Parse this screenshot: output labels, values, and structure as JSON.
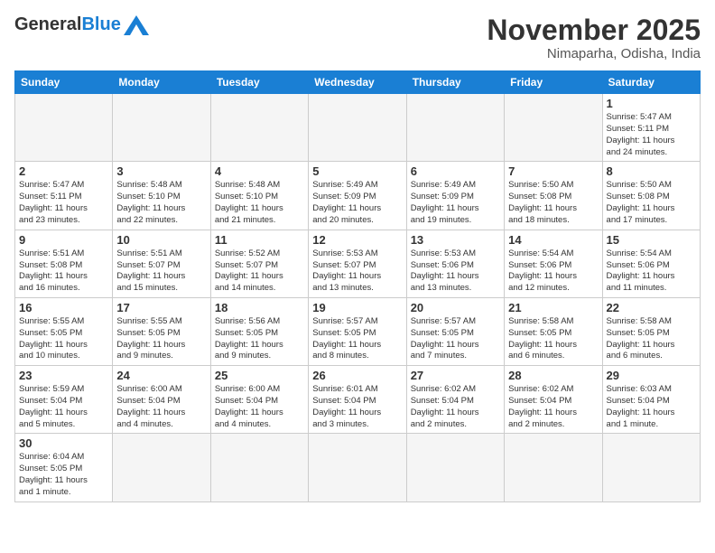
{
  "header": {
    "logo_general": "General",
    "logo_blue": "Blue",
    "month_title": "November 2025",
    "location": "Nimaparha, Odisha, India"
  },
  "days_of_week": [
    "Sunday",
    "Monday",
    "Tuesday",
    "Wednesday",
    "Thursday",
    "Friday",
    "Saturday"
  ],
  "weeks": [
    [
      {
        "day": "",
        "info": ""
      },
      {
        "day": "",
        "info": ""
      },
      {
        "day": "",
        "info": ""
      },
      {
        "day": "",
        "info": ""
      },
      {
        "day": "",
        "info": ""
      },
      {
        "day": "",
        "info": ""
      },
      {
        "day": "1",
        "info": "Sunrise: 5:47 AM\nSunset: 5:11 PM\nDaylight: 11 hours\nand 24 minutes."
      }
    ],
    [
      {
        "day": "2",
        "info": "Sunrise: 5:47 AM\nSunset: 5:11 PM\nDaylight: 11 hours\nand 23 minutes."
      },
      {
        "day": "3",
        "info": "Sunrise: 5:48 AM\nSunset: 5:10 PM\nDaylight: 11 hours\nand 22 minutes."
      },
      {
        "day": "4",
        "info": "Sunrise: 5:48 AM\nSunset: 5:10 PM\nDaylight: 11 hours\nand 21 minutes."
      },
      {
        "day": "5",
        "info": "Sunrise: 5:49 AM\nSunset: 5:09 PM\nDaylight: 11 hours\nand 20 minutes."
      },
      {
        "day": "6",
        "info": "Sunrise: 5:49 AM\nSunset: 5:09 PM\nDaylight: 11 hours\nand 19 minutes."
      },
      {
        "day": "7",
        "info": "Sunrise: 5:50 AM\nSunset: 5:08 PM\nDaylight: 11 hours\nand 18 minutes."
      },
      {
        "day": "8",
        "info": "Sunrise: 5:50 AM\nSunset: 5:08 PM\nDaylight: 11 hours\nand 17 minutes."
      }
    ],
    [
      {
        "day": "9",
        "info": "Sunrise: 5:51 AM\nSunset: 5:08 PM\nDaylight: 11 hours\nand 16 minutes."
      },
      {
        "day": "10",
        "info": "Sunrise: 5:51 AM\nSunset: 5:07 PM\nDaylight: 11 hours\nand 15 minutes."
      },
      {
        "day": "11",
        "info": "Sunrise: 5:52 AM\nSunset: 5:07 PM\nDaylight: 11 hours\nand 14 minutes."
      },
      {
        "day": "12",
        "info": "Sunrise: 5:53 AM\nSunset: 5:07 PM\nDaylight: 11 hours\nand 13 minutes."
      },
      {
        "day": "13",
        "info": "Sunrise: 5:53 AM\nSunset: 5:06 PM\nDaylight: 11 hours\nand 13 minutes."
      },
      {
        "day": "14",
        "info": "Sunrise: 5:54 AM\nSunset: 5:06 PM\nDaylight: 11 hours\nand 12 minutes."
      },
      {
        "day": "15",
        "info": "Sunrise: 5:54 AM\nSunset: 5:06 PM\nDaylight: 11 hours\nand 11 minutes."
      }
    ],
    [
      {
        "day": "16",
        "info": "Sunrise: 5:55 AM\nSunset: 5:05 PM\nDaylight: 11 hours\nand 10 minutes."
      },
      {
        "day": "17",
        "info": "Sunrise: 5:55 AM\nSunset: 5:05 PM\nDaylight: 11 hours\nand 9 minutes."
      },
      {
        "day": "18",
        "info": "Sunrise: 5:56 AM\nSunset: 5:05 PM\nDaylight: 11 hours\nand 9 minutes."
      },
      {
        "day": "19",
        "info": "Sunrise: 5:57 AM\nSunset: 5:05 PM\nDaylight: 11 hours\nand 8 minutes."
      },
      {
        "day": "20",
        "info": "Sunrise: 5:57 AM\nSunset: 5:05 PM\nDaylight: 11 hours\nand 7 minutes."
      },
      {
        "day": "21",
        "info": "Sunrise: 5:58 AM\nSunset: 5:05 PM\nDaylight: 11 hours\nand 6 minutes."
      },
      {
        "day": "22",
        "info": "Sunrise: 5:58 AM\nSunset: 5:05 PM\nDaylight: 11 hours\nand 6 minutes."
      }
    ],
    [
      {
        "day": "23",
        "info": "Sunrise: 5:59 AM\nSunset: 5:04 PM\nDaylight: 11 hours\nand 5 minutes."
      },
      {
        "day": "24",
        "info": "Sunrise: 6:00 AM\nSunset: 5:04 PM\nDaylight: 11 hours\nand 4 minutes."
      },
      {
        "day": "25",
        "info": "Sunrise: 6:00 AM\nSunset: 5:04 PM\nDaylight: 11 hours\nand 4 minutes."
      },
      {
        "day": "26",
        "info": "Sunrise: 6:01 AM\nSunset: 5:04 PM\nDaylight: 11 hours\nand 3 minutes."
      },
      {
        "day": "27",
        "info": "Sunrise: 6:02 AM\nSunset: 5:04 PM\nDaylight: 11 hours\nand 2 minutes."
      },
      {
        "day": "28",
        "info": "Sunrise: 6:02 AM\nSunset: 5:04 PM\nDaylight: 11 hours\nand 2 minutes."
      },
      {
        "day": "29",
        "info": "Sunrise: 6:03 AM\nSunset: 5:04 PM\nDaylight: 11 hours\nand 1 minute."
      }
    ],
    [
      {
        "day": "30",
        "info": "Sunrise: 6:04 AM\nSunset: 5:05 PM\nDaylight: 11 hours\nand 1 minute."
      },
      {
        "day": "",
        "info": ""
      },
      {
        "day": "",
        "info": ""
      },
      {
        "day": "",
        "info": ""
      },
      {
        "day": "",
        "info": ""
      },
      {
        "day": "",
        "info": ""
      },
      {
        "day": "",
        "info": ""
      }
    ]
  ]
}
